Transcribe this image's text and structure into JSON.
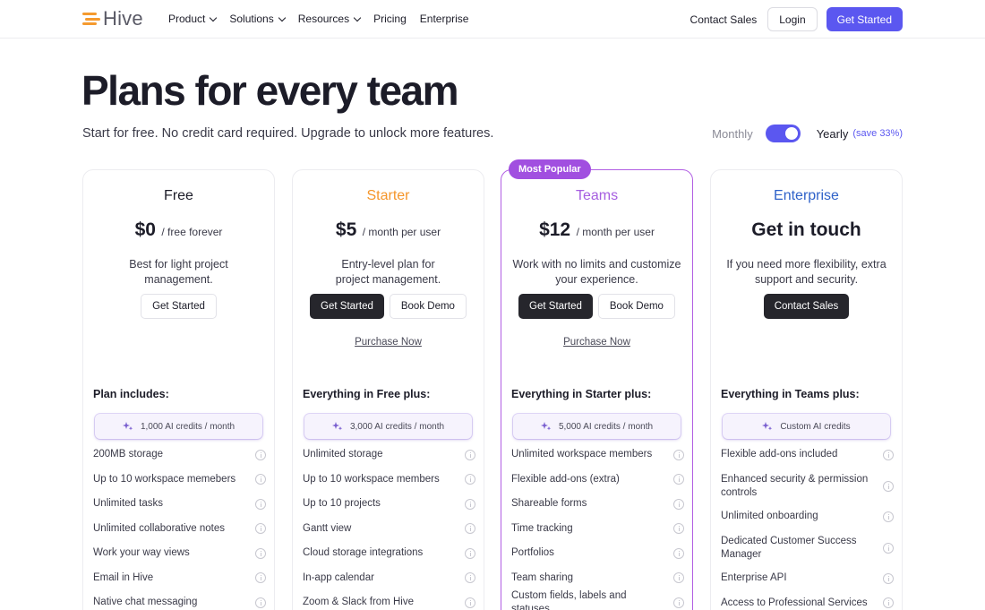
{
  "nav": {
    "logo": "Hive",
    "links": [
      "Product",
      "Solutions",
      "Resources",
      "Pricing",
      "Enterprise"
    ],
    "contact_sales": "Contact Sales",
    "login": "Login",
    "get_started": "Get Started"
  },
  "hero": {
    "title": "Plans for every team",
    "subtitle": "Start for free. No credit card required. Upgrade to unlock more features."
  },
  "billing": {
    "monthly": "Monthly",
    "yearly": "Yearly",
    "save": "(save 33%)",
    "selected": "Yearly"
  },
  "plans": [
    {
      "name": "Free",
      "name_color": "#1c1c28",
      "price": "$0",
      "period": "/ free forever",
      "description": "Best for light project management.",
      "primary_btn": "",
      "secondary_btn": "Get Started",
      "purchase": "",
      "includes": "Plan includes:",
      "credits": "1,000 AI credits / month",
      "features": [
        "200MB storage",
        "Up to 10 workspace memebers",
        "Unlimited tasks",
        "Unlimited collaborative notes",
        "Work your way views",
        "Email in Hive",
        "Native chat messaging"
      ]
    },
    {
      "name": "Starter",
      "name_color": "#f5962a",
      "price": "$5",
      "period": "/ month per user",
      "description": "Entry-level plan for project management.",
      "primary_btn": "Get Started",
      "secondary_btn": "Book Demo",
      "purchase": "Purchase Now",
      "includes": "Everything in Free plus:",
      "credits": "3,000 AI credits / month",
      "features": [
        "Unlimited storage",
        "Up to 10 workspace members",
        "Up to 10 projects",
        "Gantt view",
        "Cloud storage integrations",
        "In-app calendar",
        "Zoom & Slack from Hive"
      ]
    },
    {
      "name": "Teams",
      "name_color": "#a65ee0",
      "badge": "Most Popular",
      "price": "$12",
      "period": "/ month per user",
      "description": "Work with no limits and customize your experience.",
      "primary_btn": "Get Started",
      "secondary_btn": "Book Demo",
      "purchase": "Purchase Now",
      "includes": "Everything in Starter plus:",
      "credits": "5,000 AI credits / month",
      "features": [
        "Unlimited workspace members",
        "Flexible add-ons (extra)",
        "Shareable forms",
        "Time tracking",
        "Portfolios",
        "Team sharing",
        "Custom fields, labels and statuses"
      ]
    },
    {
      "name": "Enterprise",
      "name_color": "#2f62c9",
      "price": "Get in touch",
      "period": "",
      "description": "If you need more flexibility, extra support and security.",
      "primary_btn": "Contact Sales",
      "secondary_btn": "",
      "purchase": "",
      "includes": "Everything in Teams plus:",
      "credits": "Custom AI credits",
      "features": [
        "Flexible add-ons included",
        "Enhanced security & permission controls",
        "Unlimited onboarding",
        "Dedicated Customer Success Manager",
        "Enterprise API",
        "Access to Professional Services"
      ]
    }
  ],
  "colors": {
    "accent": "#5b57f0",
    "popular_border": "#b15ee3",
    "badge": "#a14fe0"
  },
  "icons": [
    "chevron-down-icon",
    "sparkle-icon",
    "info-icon",
    "hive-logo-icon"
  ]
}
